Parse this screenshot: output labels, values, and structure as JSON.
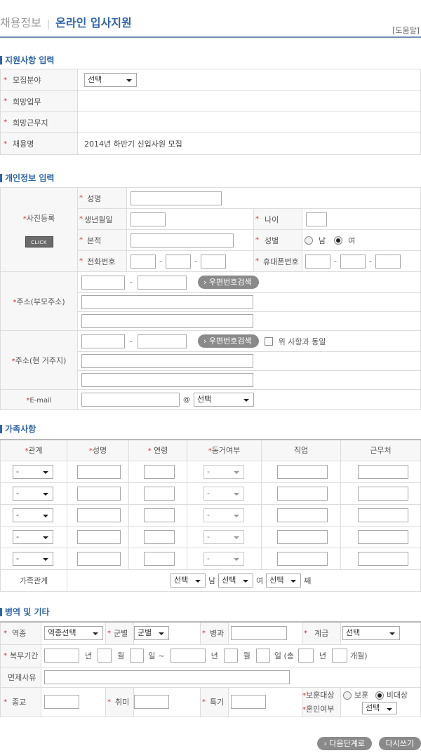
{
  "header": {
    "category": "채용정보",
    "title": "온라인 입사지원",
    "help": "[도움말]"
  },
  "apply": {
    "section_title": "지원사항 입력",
    "recruit_label": "모집분야",
    "recruit_select": "선택",
    "job_label": "희망업무",
    "location_label": "희망근무지",
    "posting_label": "채용명",
    "posting_value": "2014년 하반기 신입사원 모집"
  },
  "personal": {
    "section_title": "개인정보 입력",
    "photo_label": "사진등록",
    "click_label": "CLICK",
    "name_label": "성명",
    "birth_label": "생년월일",
    "age_label": "나이",
    "origin_label": "본적",
    "gender_label": "성별",
    "gender_male": "남",
    "gender_female": "여",
    "gender_selected": "여",
    "phone_label": "전화번호",
    "mobile_label": "휴대폰번호",
    "dash": "-",
    "addr_parent_label": "주소(부모주소)",
    "addr_current_label": "주소(현 거주지)",
    "zip_search": "› 우편번호검색",
    "same_as_above": "위 사항과 동일",
    "email_label": "E-mail",
    "at": "@",
    "email_select": "선택"
  },
  "family": {
    "section_title": "가족사항",
    "columns": [
      "관계",
      "성명",
      "연령",
      "동거여부",
      "직업",
      "근무처"
    ],
    "row_select": "-",
    "rows": 5,
    "relation_label": "가족관계",
    "relation_select": "선택",
    "male": "남",
    "female": "여",
    "order": "째"
  },
  "military": {
    "section_title": "병역 및 기타",
    "branch_label": "역종",
    "branch_select": "역종선택",
    "army_label": "군별",
    "army_select": "군별",
    "specialty_label": "병과",
    "rank_label": "계급",
    "rank_select": "선택",
    "period_label": "복무기간",
    "year": "년",
    "month": "월",
    "day": "일",
    "tilde": "~",
    "total_open": "일 (총",
    "months_close": "개월)",
    "exempt_label": "면제사유",
    "religion_label": "종교",
    "hobby_label": "취미",
    "skill_label": "특기",
    "veteran_label": "보훈대상",
    "veteran_yes": "보훈",
    "veteran_no": "비대상",
    "veteran_selected": "비대상",
    "marital_label": "혼인여부",
    "marital_select": "선택"
  },
  "footer": {
    "next_button": "› 다음단계로",
    "rewrite_button": "다시쓰기"
  },
  "colors": {
    "accent": "#2d64a8",
    "required": "#d23030",
    "button_gray": "#8a8a8a",
    "label_bg": "#f7f7f7"
  }
}
